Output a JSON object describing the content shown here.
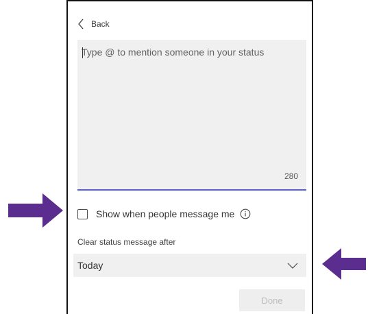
{
  "back": {
    "label": "Back"
  },
  "status": {
    "placeholder": "Type @ to mention someone in your status",
    "value": "",
    "char_count": "280"
  },
  "show_when_messaged": {
    "label": "Show when people message me",
    "checked": false
  },
  "clear_after": {
    "label": "Clear status message after",
    "selected": "Today"
  },
  "done": {
    "label": "Done",
    "enabled": false
  },
  "colors": {
    "accent": "#5b5fc7",
    "arrow": "#5b2d8e",
    "field_bg": "#f0f0f0"
  },
  "icons": {
    "back": "chevron-left-icon",
    "info": "info-icon",
    "dropdown": "chevron-down-icon"
  }
}
